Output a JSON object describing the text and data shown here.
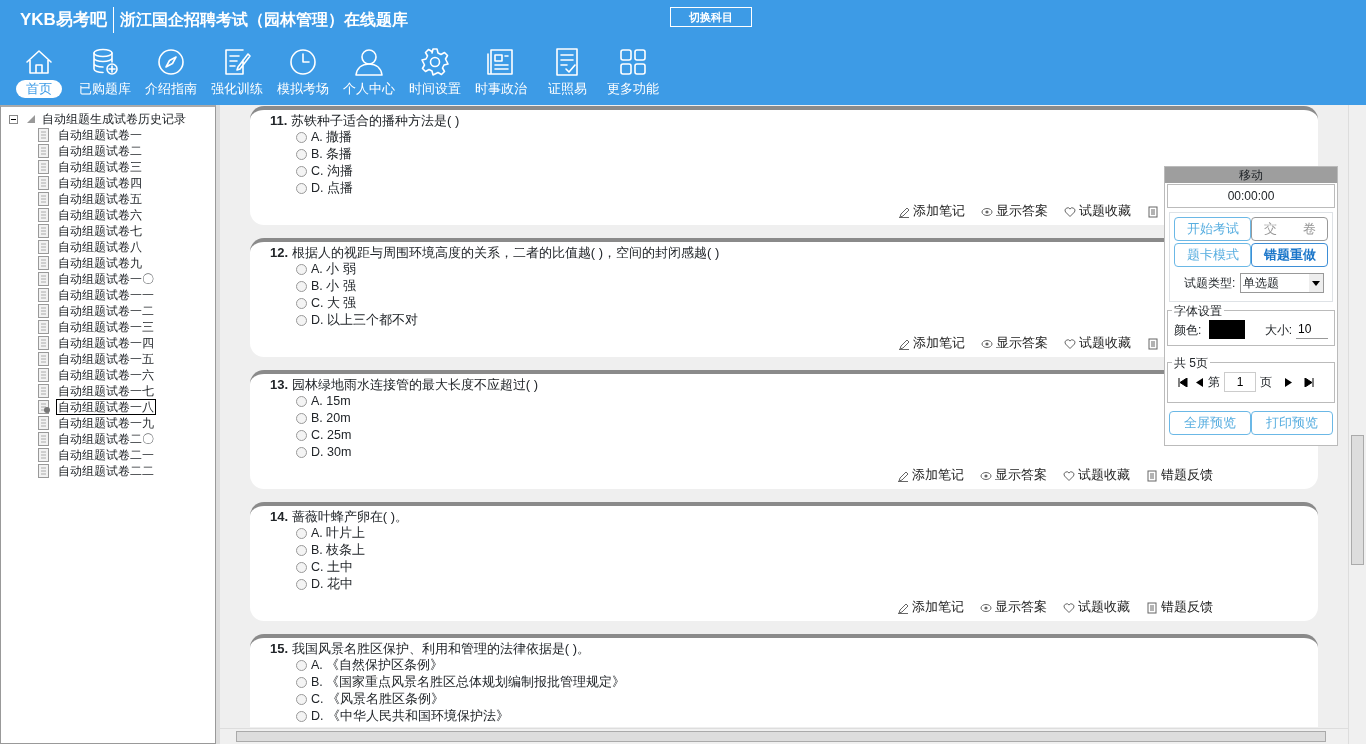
{
  "header": {
    "logo": "YKB易考吧",
    "title": "浙江国企招聘考试（园林管理）在线题库",
    "switch_button": "切换科目"
  },
  "nav": [
    {
      "label": "首页",
      "kind": "home",
      "selected": true
    },
    {
      "label": "已购题库",
      "kind": "database",
      "selected": false
    },
    {
      "label": "介绍指南",
      "kind": "compass",
      "selected": false
    },
    {
      "label": "强化训练",
      "kind": "edit",
      "selected": false
    },
    {
      "label": "模拟考场",
      "kind": "clock",
      "selected": false
    },
    {
      "label": "个人中心",
      "kind": "person",
      "selected": false
    },
    {
      "label": "时间设置",
      "kind": "gear",
      "selected": false
    },
    {
      "label": "时事政治",
      "kind": "news",
      "selected": false
    },
    {
      "label": "证照易",
      "kind": "checklist",
      "selected": false
    },
    {
      "label": "更多功能",
      "kind": "grid",
      "selected": false
    }
  ],
  "tree": {
    "label": "自动组题生成试卷历史记录",
    "expanded": true,
    "children": [
      {
        "label": "自动组题试卷一",
        "selected": false
      },
      {
        "label": "自动组题试卷二",
        "selected": false
      },
      {
        "label": "自动组题试卷三",
        "selected": false
      },
      {
        "label": "自动组题试卷四",
        "selected": false
      },
      {
        "label": "自动组题试卷五",
        "selected": false
      },
      {
        "label": "自动组题试卷六",
        "selected": false
      },
      {
        "label": "自动组题试卷七",
        "selected": false
      },
      {
        "label": "自动组题试卷八",
        "selected": false
      },
      {
        "label": "自动组题试卷九",
        "selected": false
      },
      {
        "label": "自动组题试卷一〇",
        "selected": false
      },
      {
        "label": "自动组题试卷一一",
        "selected": false
      },
      {
        "label": "自动组题试卷一二",
        "selected": false
      },
      {
        "label": "自动组题试卷一三",
        "selected": false
      },
      {
        "label": "自动组题试卷一四",
        "selected": false
      },
      {
        "label": "自动组题试卷一五",
        "selected": false
      },
      {
        "label": "自动组题试卷一六",
        "selected": false
      },
      {
        "label": "自动组题试卷一七",
        "selected": false
      },
      {
        "label": "自动组题试卷一八",
        "selected": true
      },
      {
        "label": "自动组题试卷一九",
        "selected": false
      },
      {
        "label": "自动组题试卷二〇",
        "selected": false
      },
      {
        "label": "自动组题试卷二一",
        "selected": false
      },
      {
        "label": "自动组题试卷二二",
        "selected": false
      }
    ]
  },
  "questions": [
    {
      "number": "11.",
      "text": "苏铁种子适合的播种方法是( )",
      "options": [
        {
          "label": "A. 撒播",
          "checked": false
        },
        {
          "label": "B. 条播",
          "checked": false
        },
        {
          "label": "C. 沟播",
          "checked": false
        },
        {
          "label": "D. 点播",
          "checked": false
        }
      ],
      "actions": [
        {
          "kind": "note",
          "label": "添加笔记"
        },
        {
          "kind": "answer",
          "label": "显示答案"
        },
        {
          "kind": "favorite",
          "label": "试题收藏"
        },
        {
          "kind": "feedback"
        }
      ]
    },
    {
      "number": "12.",
      "text": "根据人的视距与周围环境高度的关系，二者的比值越( )，空间的封闭感越( )",
      "options": [
        {
          "label": "A. 小 弱",
          "checked": false
        },
        {
          "label": "B. 小 强",
          "checked": false
        },
        {
          "label": "C. 大 强",
          "checked": false
        },
        {
          "label": "D. 以上三个都不对",
          "checked": false
        }
      ],
      "actions": [
        {
          "kind": "note",
          "label": "添加笔记"
        },
        {
          "kind": "answer",
          "label": "显示答案"
        },
        {
          "kind": "favorite",
          "label": "试题收藏"
        },
        {
          "kind": "feedback"
        }
      ]
    },
    {
      "number": "13.",
      "text": "园林绿地雨水连接管的最大长度不应超过( )",
      "options": [
        {
          "label": "A. 15m",
          "checked": false
        },
        {
          "label": "B. 20m",
          "checked": false
        },
        {
          "label": "C. 25m",
          "checked": false
        },
        {
          "label": "D. 30m",
          "checked": false
        }
      ],
      "actions": [
        {
          "kind": "note",
          "label": "添加笔记"
        },
        {
          "kind": "answer",
          "label": "显示答案"
        },
        {
          "kind": "favorite",
          "label": "试题收藏"
        },
        {
          "kind": "feedback",
          "label": "错题反馈"
        }
      ]
    },
    {
      "number": "14.",
      "text": "蔷薇叶蜂产卵在( )。",
      "options": [
        {
          "label": "A. 叶片上",
          "checked": false
        },
        {
          "label": "B. 枝条上",
          "checked": false
        },
        {
          "label": "C. 土中",
          "checked": false
        },
        {
          "label": "D. 花中",
          "checked": false
        }
      ],
      "actions": [
        {
          "kind": "note",
          "label": "添加笔记"
        },
        {
          "kind": "answer",
          "label": "显示答案"
        },
        {
          "kind": "favorite",
          "label": "试题收藏"
        },
        {
          "kind": "feedback",
          "label": "错题反馈"
        }
      ]
    },
    {
      "number": "15.",
      "text": "我国风景名胜区保护、利用和管理的法律依据是( )。",
      "options": [
        {
          "label": "A. 《自然保护区条例》",
          "checked": false
        },
        {
          "label": "B. 《国家重点风景名胜区总体规划编制报批管理规定》",
          "checked": false
        },
        {
          "label": "C. 《风景名胜区条例》",
          "checked": false
        },
        {
          "label": "D. 《中华人民共和国环境保护法》",
          "checked": false
        }
      ]
    }
  ],
  "panel": {
    "title": "移动",
    "timer": "00:00:00",
    "buttons": [
      {
        "label": "开始考试",
        "selected": false
      },
      {
        "label": "交　　卷",
        "selected": false
      },
      {
        "label": "题卡模式",
        "selected": false
      },
      {
        "label": "错题重做",
        "selected": true
      }
    ],
    "type_label": "试题类型:",
    "type_value": "单选题",
    "font_group": "字体设置",
    "color_label": "颜色:",
    "color": "#000000",
    "size_label": "大小:",
    "size_value": "10",
    "page_group": "共 5页",
    "page_prefix": "第",
    "page_value": "1",
    "page_suffix": "页",
    "preview_buttons": [
      "全屏预览",
      "打印预览"
    ]
  }
}
